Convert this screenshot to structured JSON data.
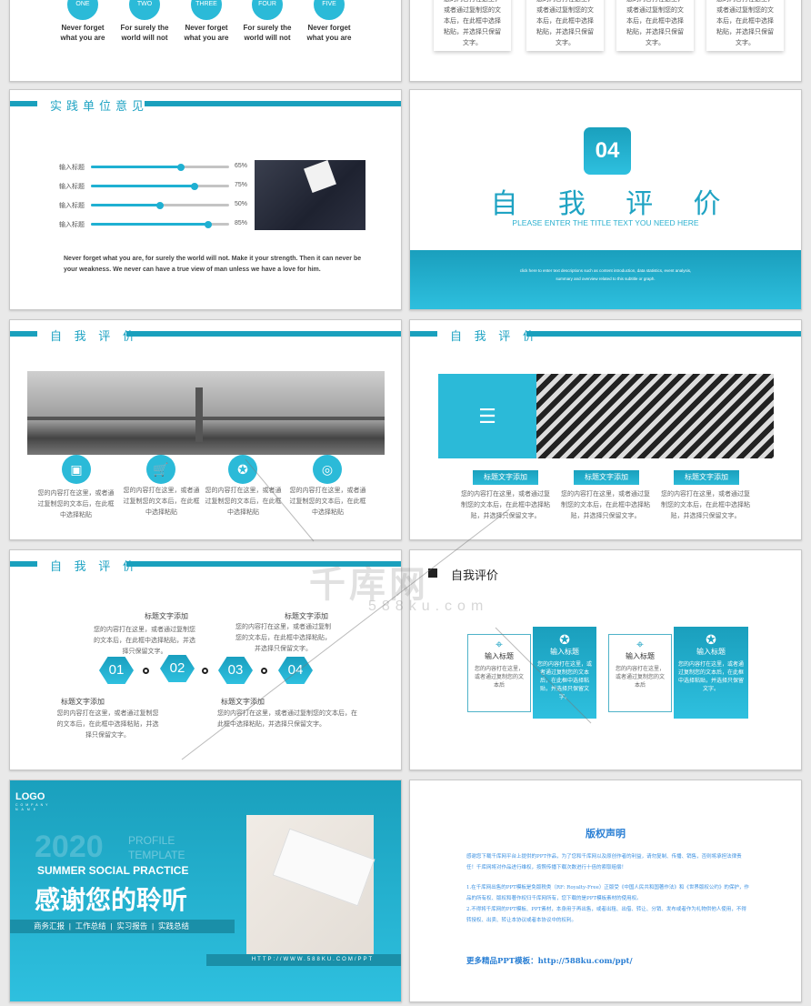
{
  "colors": {
    "accent": "#1fa3c3",
    "accent_light": "#2bbad8"
  },
  "slide_top_left": {
    "circles": [
      "ONE",
      "TWO",
      "THREE",
      "FOUR",
      "FIVE"
    ],
    "captions": [
      [
        "Never forget",
        "what you are"
      ],
      [
        "For surely the",
        "world will not"
      ],
      [
        "Never forget",
        "what you are"
      ],
      [
        "For surely the",
        "world will not"
      ],
      [
        "Never forget",
        "what you are"
      ]
    ]
  },
  "slide_top_right": {
    "cards": [
      "您的内容打在这里，或者通过复制您的文本后，在此框中选择粘贴，并选择只保留文字。",
      "您的内容打在这里，或者通过复制您的文本后，在此框中选择粘贴，并选择只保留文字。",
      "您的内容打在这里，或者通过复制您的文本后，在此框中选择粘贴，并选择只保留文字。",
      "您的内容打在这里，或者通过复制您的文本后，在此框中选择粘贴，并选择只保留文字。"
    ]
  },
  "slide_opinion": {
    "title": "实践单位意见",
    "bars": [
      {
        "label": "输入标题",
        "value": 65,
        "text": "65%"
      },
      {
        "label": "输入标题",
        "value": 75,
        "text": "75%"
      },
      {
        "label": "输入标题",
        "value": 50,
        "text": "50%"
      },
      {
        "label": "输入标题",
        "value": 85,
        "text": "85%"
      }
    ],
    "quote": "Never forget what you are, for surely the world will not. Make it your strength. Then it can never be your weakness. We never can have a true view of man unless we have a love for him."
  },
  "slide_section": {
    "number": "04",
    "title": "自 我 评 价",
    "subtitle": "PLEASE ENTER THE TITLE TEXT YOU NEED HERE",
    "desc1": "click here to enter text descriptions such as content introduction, data statistics, event analysis,",
    "desc2": "summary and overview related to this subtitle or graph."
  },
  "slide_bridge": {
    "title": "自 我 评 价",
    "icons": [
      "toolbox-icon",
      "cart-icon",
      "award-icon",
      "target-icon"
    ],
    "text": "您的内容打在这里，或者通过复制您的文本后，在此框中选择粘贴"
  },
  "slide_building": {
    "title": "自 我 评 价",
    "buttons": [
      "标题文字添加",
      "标题文字添加",
      "标题文字添加"
    ],
    "text": "您的内容打在这里，或者通过复制您的文本后，在此框中选择粘贴，并选择只保留文字。"
  },
  "slide_steps": {
    "title": "自 我 评 价",
    "steps": [
      "01",
      "02",
      "03",
      "04"
    ],
    "heading": "标题文字添加",
    "text": "您的内容打在这里，或者通过复制您的文本后，在此框中选择粘贴，并选择只保留文字。"
  },
  "slide_boxes": {
    "title": "自我评价",
    "box_title": "输入标题",
    "short_text": "您的内容打在这里，或者通过复制您的文本后",
    "long_text": "您的内容打在这里，或者通过复制您的文本后，在此框中选择粘贴，并选择只保留文字。"
  },
  "slide_thanks": {
    "logo": "LOGO",
    "company": "COMPANY",
    "name": "NAME",
    "year": "2020",
    "profile1": "PROFILE",
    "profile2": "TEMPLATE",
    "english": "SUMMER SOCIAL PRACTICE",
    "title": "感谢您的聆听",
    "tags": "商务汇报  |  工作总结  |  实习报告  |  实践总结",
    "url": "HTTP://WWW.588KU.COM/PPT"
  },
  "slide_copyright": {
    "title": "版权声明",
    "p1": "感谢您下载千库网平台上提供的PPT作品，为了您和千库网以及原创作者的利益，请勿复制、传播、销售，否则将承担法律责任！千库网将对作品进行维权，按照传播下载次数进行十倍的索取赔偿！",
    "p2": "1.在千库网出售的PPT模板是免版税类（RF: Royalty-Free）正版受《中国人民共和国著作法》和《世界版权公约》的保护，作品的所有权、版权和著作权归千库网所有，您下载的是PPT模板素材的使用权。",
    "p3": "2.不得将千库网的PPT模板、PPT素材，本身用于再出售，或者出租、出借、转让、分销、发布或者作为礼物供他人使用，不得转授权、出卖、转让本协议或者本协议中的权利。",
    "more": "更多精品PPT模板：http://588ku.com/ppt/"
  },
  "watermark": {
    "brand": "千库网",
    "domain": "588ku.com"
  }
}
